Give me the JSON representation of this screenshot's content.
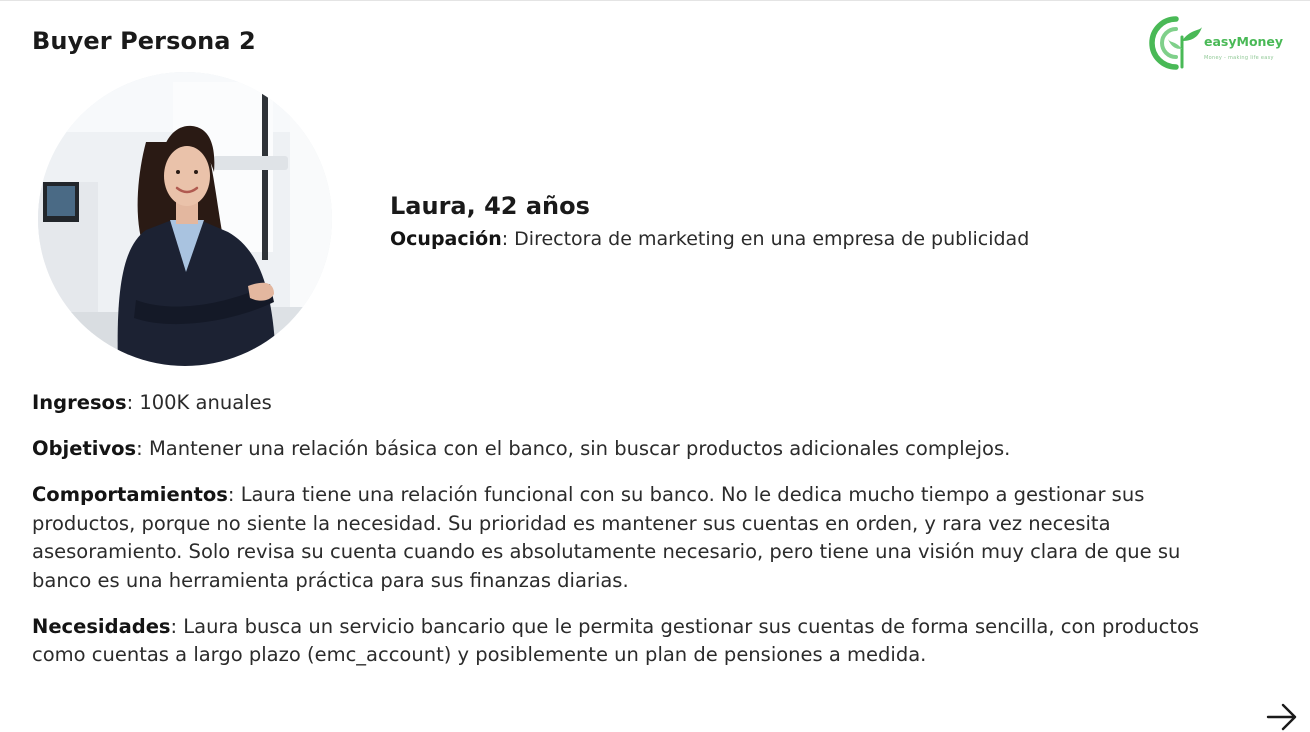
{
  "header": {
    "title": "Buyer Persona 2"
  },
  "logo": {
    "brand": "easyMoney",
    "tagline": "Money - making life easy",
    "color": "#49b956"
  },
  "persona": {
    "name": "Laura, 42 años",
    "occupation_label": "Ocupación",
    "occupation_value": ": Directora de marketing en una empresa de publicidad"
  },
  "details": {
    "income_label": "Ingresos",
    "income_value": ": 100K anuales",
    "goals_label": "Objetivos",
    "goals_value": ": Mantener una relación básica con el banco, sin buscar productos adicionales complejos.",
    "behaviors_label": "Comportamientos",
    "behaviors_value": ": Laura tiene una relación funcional con su banco. No le dedica mucho tiempo a gestionar sus productos, porque no siente la necesidad. Su prioridad es mantener sus cuentas en orden, y rara vez necesita asesoramiento. Solo revisa su cuenta cuando es absolutamente necesario, pero tiene una visión muy clara de que su banco es una herramienta práctica para sus finanzas diarias.",
    "needs_label": "Necesidades",
    "needs_value": ": Laura busca un servicio bancario que le permita gestionar sus cuentas de forma sencilla, con productos como cuentas a largo plazo (emc_account) y posiblemente un plan de pensiones a medida."
  },
  "navigation": {
    "next_icon": "arrow-right-icon"
  }
}
